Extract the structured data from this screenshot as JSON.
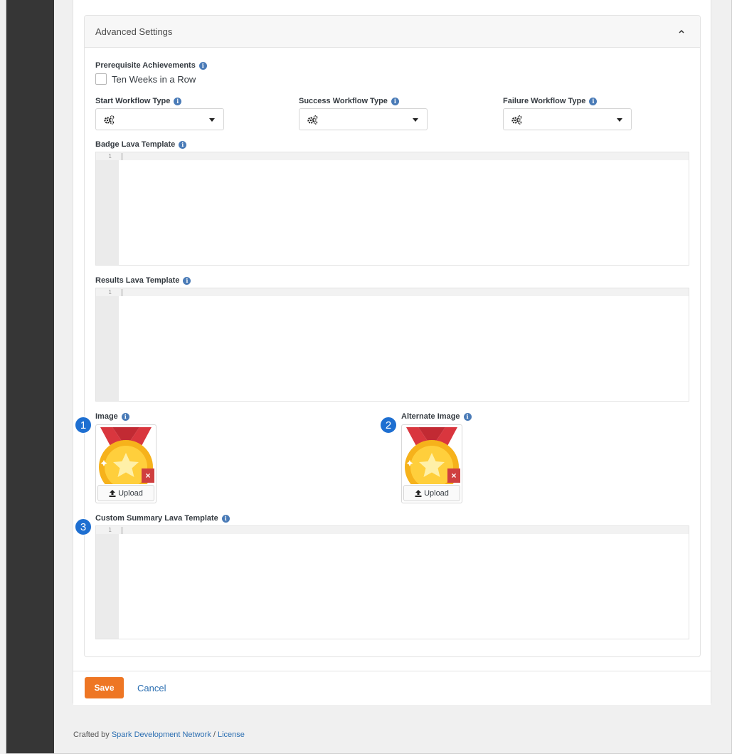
{
  "advanced_settings": {
    "title": "Advanced Settings"
  },
  "prerequisite": {
    "label": "Prerequisite Achievements",
    "option_label": "Ten Weeks in a Row",
    "checked": false
  },
  "workflows": {
    "start_label": "Start Workflow Type",
    "success_label": "Success Workflow Type",
    "failure_label": "Failure Workflow Type"
  },
  "badge_template": {
    "label": "Badge Lava Template",
    "line_number": "1"
  },
  "results_template": {
    "label": "Results Lava Template",
    "line_number": "1"
  },
  "image": {
    "label": "Image",
    "step": "1",
    "upload_label": "Upload",
    "remove_label": "×"
  },
  "alternate_image": {
    "label": "Alternate Image",
    "step": "2",
    "upload_label": "Upload",
    "remove_label": "×"
  },
  "custom_summary": {
    "label": "Custom Summary Lava Template",
    "step": "3",
    "line_number": "1"
  },
  "actions": {
    "save_label": "Save",
    "cancel_label": "Cancel"
  },
  "footer": {
    "prefix": "Crafted by ",
    "link1": "Spark Development Network",
    "separator": " / ",
    "link2": "License"
  },
  "colors": {
    "sidebar": "#363636",
    "accent_save": "#ee7624",
    "link": "#2c6fb2",
    "info_icon": "#4a7bb7",
    "step_badge": "#1e6fd1",
    "remove": "#cf3f3f"
  },
  "icons": {
    "info": "info-circle-icon",
    "workflow": "gears-icon",
    "caret": "caret-down-icon",
    "chevron": "chevron-up-icon",
    "upload": "upload-icon",
    "remove": "times-icon"
  }
}
